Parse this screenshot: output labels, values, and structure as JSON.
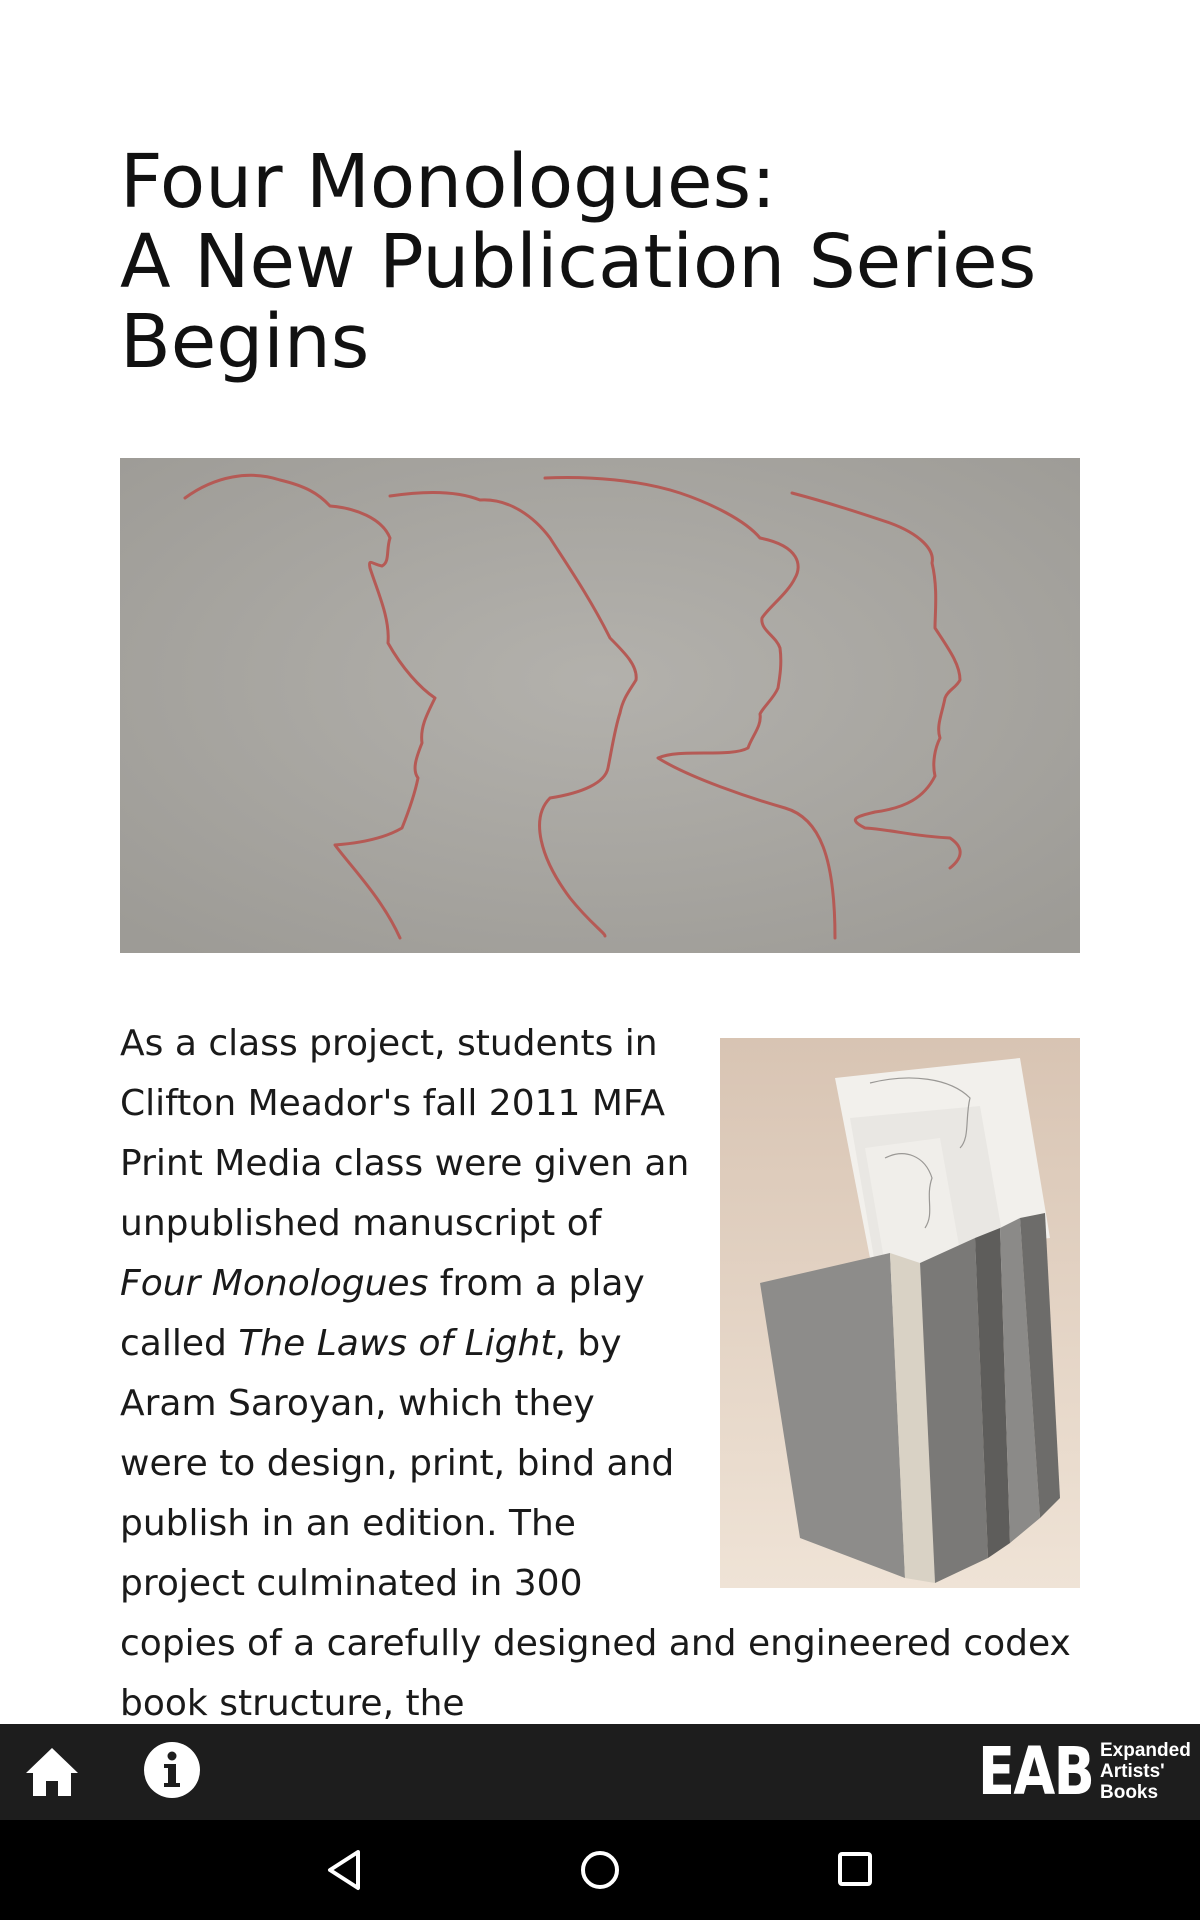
{
  "article": {
    "title_line1": "Four Monologues:",
    "title_line2": "A New Publication Series",
    "title_line3": "Begins",
    "body": {
      "p1": "As a class project, students in Clifton Meador's fall 2011 MFA Print Media class were given an unpublished manuscript of ",
      "em1": "Four Monologues",
      "p2": " from a play called ",
      "em2": "The Laws of Light",
      "p3": ", by Aram Saroyan, which they were to design, print, bind and publish in an edition. The project culminated in 300 copies of a carefully designed and engineered codex book structure, the"
    }
  },
  "toolbar": {
    "home_icon": "home-icon",
    "info_icon": "info-icon",
    "logo": {
      "mark": "EAB",
      "line1": "Expanded",
      "line2": "Artists'",
      "line3": "Books"
    }
  },
  "system_nav": {
    "back_icon": "back-triangle-icon",
    "home_icon": "home-circle-icon",
    "recents_icon": "recents-square-icon"
  },
  "colors": {
    "toolbar_bg": "#1d1d1d",
    "nav_bg": "#000000",
    "sketch_line": "#b55a55"
  }
}
